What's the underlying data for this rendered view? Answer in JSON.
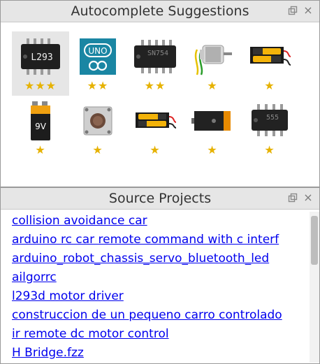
{
  "panels": {
    "autocomplete": {
      "title": "Autocomplete Suggestions",
      "controls": {
        "float_icon": "float-window-icon",
        "close_icon": "close-icon",
        "close_label": "×"
      },
      "items": [
        {
          "icon": "l293-ic-icon",
          "chip_label": "L293",
          "stars": "★★★",
          "selected": true
        },
        {
          "icon": "arduino-uno-icon",
          "chip_label": "UNO",
          "stars": "★★",
          "selected": false
        },
        {
          "icon": "sn754-ic-icon",
          "chip_label": "SN754",
          "stars": "★★",
          "selected": false
        },
        {
          "icon": "dc-motor-icon",
          "chip_label": "",
          "stars": "★",
          "selected": false
        },
        {
          "icon": "battery-holder-icon",
          "chip_label": "",
          "stars": "★",
          "selected": false
        },
        {
          "icon": "battery-9v-icon",
          "chip_label": "9V",
          "stars": "★",
          "selected": false
        },
        {
          "icon": "push-button-icon",
          "chip_label": "",
          "stars": "★",
          "selected": false
        },
        {
          "icon": "battery-holder-2-icon",
          "chip_label": "",
          "stars": "★",
          "selected": false
        },
        {
          "icon": "battery-pack-icon",
          "chip_label": "",
          "stars": "★",
          "selected": false
        },
        {
          "icon": "555-ic-icon",
          "chip_label": "555",
          "stars": "★",
          "selected": false
        }
      ]
    },
    "source_projects": {
      "title": "Source Projects",
      "controls": {
        "float_icon": "float-window-icon",
        "close_icon": "close-icon",
        "close_label": "×"
      },
      "items": [
        "collision avoidance car",
        "arduino rc car remote command with c interf",
        "arduino_robot_chassis_servo_bluetooth_led",
        "ailgorrc",
        "l293d motor driver",
        "construccion de un pequeno carro controlado",
        "ir remote dc motor control",
        "H Bridge.fzz"
      ]
    }
  },
  "colors": {
    "star": "#e6b200",
    "link": "#0000ee",
    "header_bg": "#e6e6e6",
    "arduino_blue": "#1a86a3"
  }
}
